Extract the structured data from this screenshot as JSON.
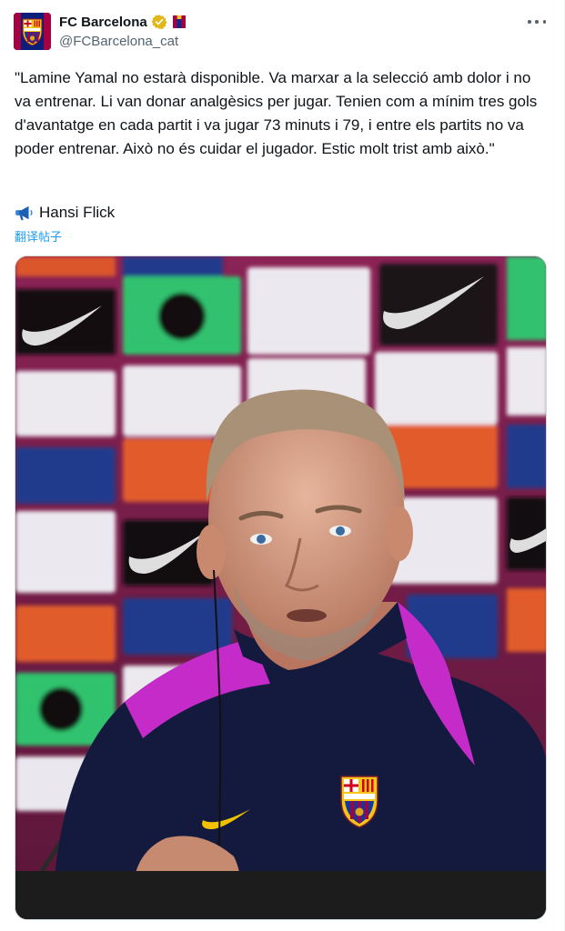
{
  "tweet": {
    "display_name": "FC Barcelona",
    "handle": "@FCBarcelona_cat",
    "text": "\"Lamine Yamal no estarà disponible. Va marxar a la selecció amb dolor i no va entrenar. Li van donar analgèsics per jugar. Tenien com a mínim tres gols d'avantatge en cada partit i va jugar 73 minuts i 79, i entre els partits no va poder entrenar. Això no és cuidar el jugador. Estic molt trist amb això.\"",
    "author_line": "Hansi Flick",
    "translate_label": "翻译帖子",
    "icons": {
      "verified": "verified-badge-icon",
      "flag": "barcelona-flag-icon",
      "more": "more-options-icon",
      "megaphone": "megaphone-icon"
    },
    "colors": {
      "accent": "#1d9bf0",
      "verified_gold": "#e2b719",
      "secondary_text": "#536471"
    }
  }
}
